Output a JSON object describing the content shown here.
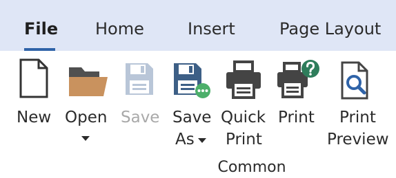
{
  "tabs": [
    {
      "label": "File",
      "active": true
    },
    {
      "label": "Home"
    },
    {
      "label": "Insert"
    },
    {
      "label": "Page Layout"
    }
  ],
  "ribbon": {
    "group_label": "Common",
    "buttons": {
      "new": {
        "label": "New",
        "icon": "blank-document-icon"
      },
      "open": {
        "label": "Open",
        "icon": "folder-icon",
        "has_dropdown": true
      },
      "save": {
        "label": "Save",
        "icon": "floppy-disk-icon",
        "disabled": true
      },
      "save_as": {
        "line1": "Save",
        "line2": "As",
        "icon": "floppy-disk-more-icon",
        "has_dropdown": true
      },
      "quick_print": {
        "line1": "Quick",
        "line2": "Print",
        "icon": "printer-icon"
      },
      "print": {
        "label": "Print",
        "icon": "printer-question-icon"
      },
      "print_preview": {
        "line1": "Print",
        "line2": "Preview",
        "icon": "document-magnifier-icon"
      }
    }
  },
  "colors": {
    "tabbar_bg": "#dfe6f6",
    "accent": "#2f63a8",
    "folder": "#c9925e",
    "disabled": "#a9a9a9",
    "save_as_badge": "#4caf6a",
    "print_badge": "#2e7d5b"
  }
}
